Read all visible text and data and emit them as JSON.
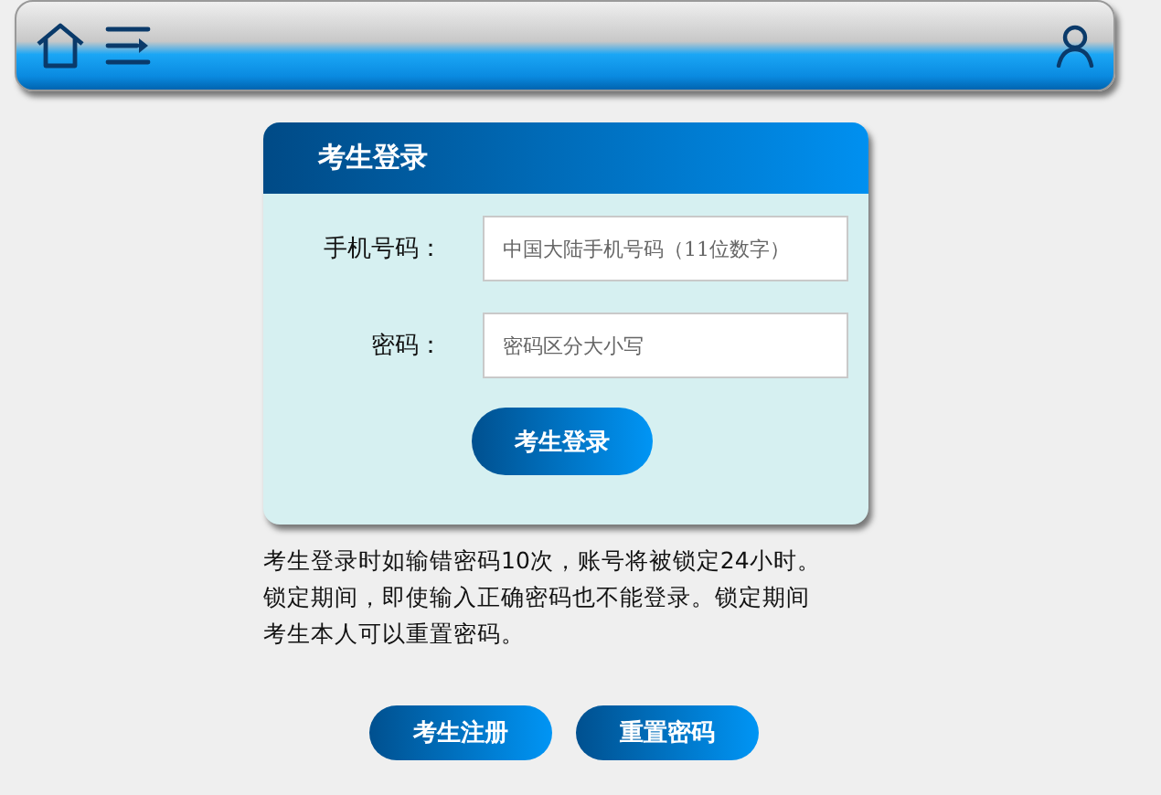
{
  "login": {
    "title": "考生登录",
    "fields": [
      {
        "label": "手机号码：",
        "placeholder": "中国大陆手机号码（11位数字）"
      },
      {
        "label": "密码：",
        "placeholder": "密码区分大小写"
      }
    ],
    "submit": "考生登录"
  },
  "notice_lines": [
    "考生登录时如输错密码10次，账号将被锁定24小时。",
    "锁定期间，即使输入正确密码也不能登录。锁定期间",
    "考生本人可以重置密码。"
  ],
  "buttons": [
    "考生注册",
    "重置密码"
  ]
}
